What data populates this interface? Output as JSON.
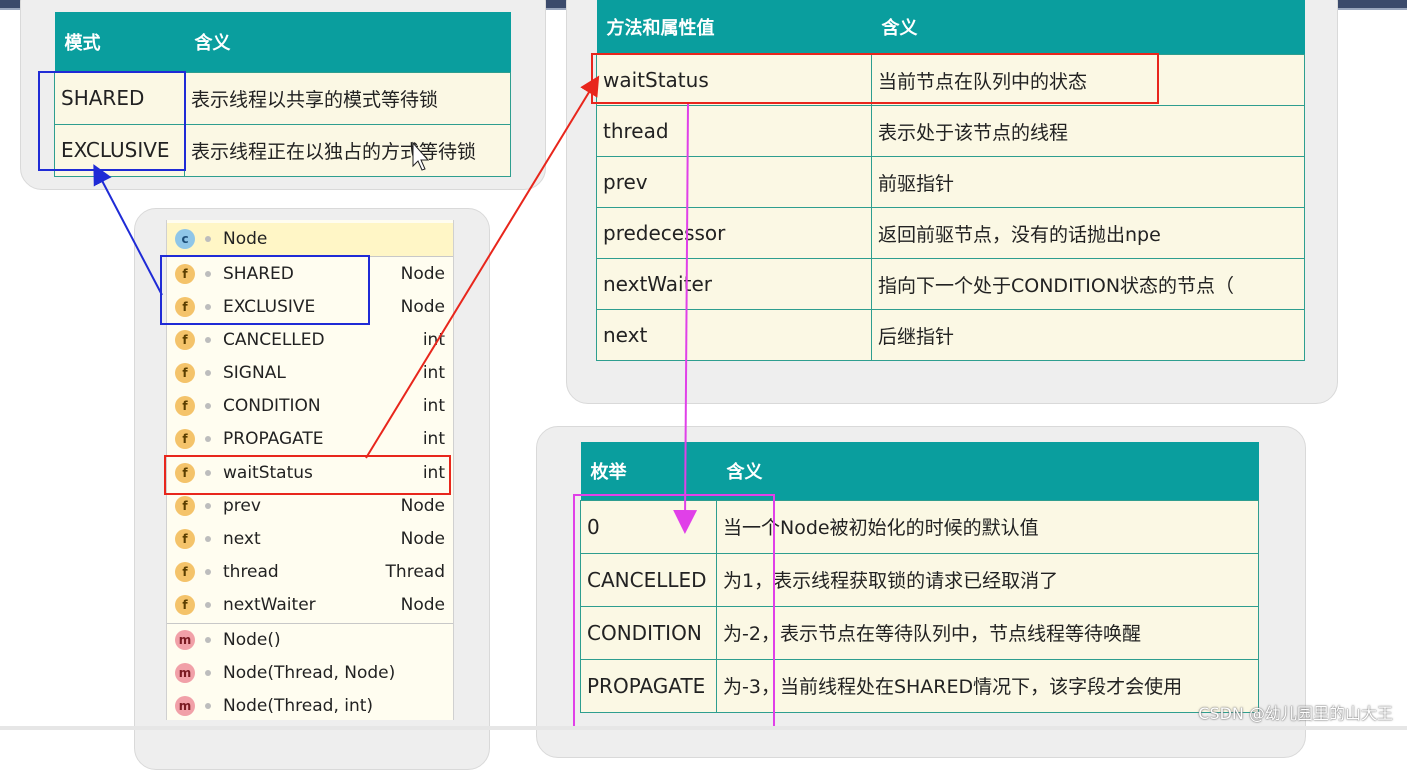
{
  "mode_table": {
    "headers": [
      "模式",
      "含义"
    ],
    "rows": [
      [
        "SHARED",
        "表示线程以共享的模式等待锁"
      ],
      [
        "EXCLUSIVE",
        "表示线程正在以独占的方式等待锁"
      ]
    ]
  },
  "attr_table": {
    "headers": [
      "方法和属性值",
      "含义"
    ],
    "rows": [
      [
        "waitStatus",
        "当前节点在队列中的状态"
      ],
      [
        "thread",
        "表示处于该节点的线程"
      ],
      [
        "prev",
        "前驱指针"
      ],
      [
        "predecessor",
        "返回前驱节点，没有的话抛出npe"
      ],
      [
        "nextWaiter",
        "指向下一个处于CONDITION状态的节点（"
      ],
      [
        "next",
        "后继指针"
      ]
    ]
  },
  "enum_table": {
    "headers": [
      "枚举",
      "含义"
    ],
    "rows": [
      [
        "0",
        "当一个Node被初始化的时候的默认值"
      ],
      [
        "CANCELLED",
        "为1，表示线程获取锁的请求已经取消了"
      ],
      [
        "CONDITION",
        "为-2，表示节点在等待队列中，节点线程等待唤醒"
      ],
      [
        "PROPAGATE",
        "为-3，当前线程处在SHARED情况下，该字段才会使用"
      ]
    ]
  },
  "node_tree": {
    "class_name": "Node",
    "class_icon": "c",
    "fields": [
      {
        "name": "SHARED",
        "type": "Node",
        "icon": "f"
      },
      {
        "name": "EXCLUSIVE",
        "type": "Node",
        "icon": "f"
      },
      {
        "name": "CANCELLED",
        "type": "int",
        "icon": "f"
      },
      {
        "name": "SIGNAL",
        "type": "int",
        "icon": "f"
      },
      {
        "name": "CONDITION",
        "type": "int",
        "icon": "f"
      },
      {
        "name": "PROPAGATE",
        "type": "int",
        "icon": "f"
      },
      {
        "name": "waitStatus",
        "type": "int",
        "icon": "f"
      },
      {
        "name": "prev",
        "type": "Node",
        "icon": "f"
      },
      {
        "name": "next",
        "type": "Node",
        "icon": "f"
      },
      {
        "name": "thread",
        "type": "Thread",
        "icon": "f"
      },
      {
        "name": "nextWaiter",
        "type": "Node",
        "icon": "f"
      }
    ],
    "methods": [
      {
        "name": "Node()",
        "icon": "m"
      },
      {
        "name": "Node(Thread, Node)",
        "icon": "m"
      },
      {
        "name": "Node(Thread, int)",
        "icon": "m"
      }
    ]
  },
  "colors": {
    "header_teal": "#0a9e9e",
    "cell_bg": "#fbf8e4",
    "blue_highlight": "#1f2bd6",
    "red_highlight": "#e8261c",
    "magenta_highlight": "#e040e8"
  },
  "watermark": "CSDN @幼儿园里的山大王"
}
